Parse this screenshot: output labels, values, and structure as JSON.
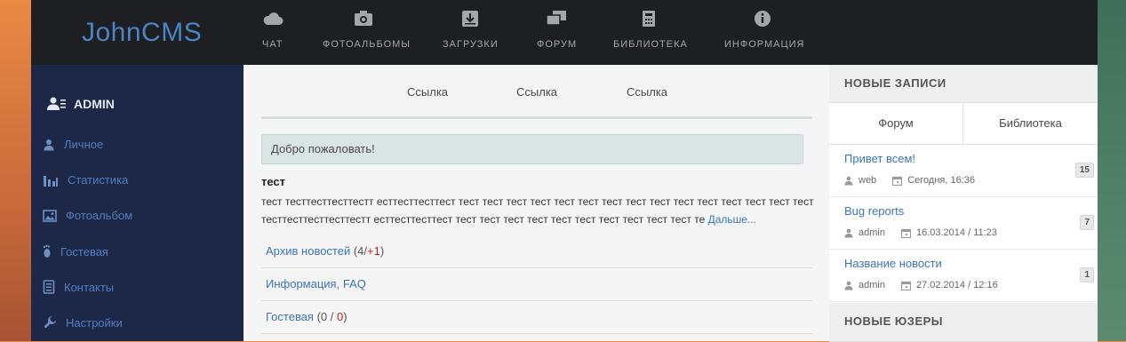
{
  "brand": "JohnCMS",
  "nav": [
    {
      "label": "ЧАТ",
      "icon": "cloud-icon"
    },
    {
      "label": "ФОТОАЛЬБОМЫ",
      "icon": "camera-icon"
    },
    {
      "label": "ЗАГРУЗКИ",
      "icon": "download-box-icon"
    },
    {
      "label": "ФОРУМ",
      "icon": "chat-bubbles-icon"
    },
    {
      "label": "БИБЛИОТЕКА",
      "icon": "book-icon"
    },
    {
      "label": "ИНФОРМАЦИЯ",
      "icon": "info-icon"
    }
  ],
  "sidebar": {
    "user": "ADMIN",
    "items": [
      {
        "label": "Личное",
        "icon": "user-icon"
      },
      {
        "label": "Статистика",
        "icon": "bar-chart-icon"
      },
      {
        "label": "Фотоальбом",
        "icon": "picture-icon"
      },
      {
        "label": "Гостевая",
        "icon": "footprint-icon"
      },
      {
        "label": "Контакты",
        "icon": "contacts-icon"
      },
      {
        "label": "Настройки",
        "icon": "wrench-icon"
      }
    ]
  },
  "main": {
    "tabs": [
      "Ссылка",
      "Ссылка",
      "Ссылка"
    ],
    "welcome": "Добро пожаловать!",
    "news": {
      "title": "тест",
      "text": "тест тесттесттесттестт ecттесттесттест тест тест тест тест тест тест тест тест тест тест тест тест тест тест тест тесттесттесттесттестт ecттесттесттест тест тест тест тест тест тест тест тест тест тест те",
      "more": "Дальше..."
    },
    "rows": [
      {
        "link": "Архив новостей",
        "open": " (4/",
        "red": "+1",
        "close": ")"
      },
      {
        "link": "Информация, FAQ"
      },
      {
        "link": "Гостевая",
        "open": " (0 / ",
        "red": "0",
        "close": ")"
      }
    ]
  },
  "right": {
    "new_posts_title": "НОВЫЕ ЗАПИСИ",
    "tabs": [
      "Форум",
      "Библиотека"
    ],
    "posts": [
      {
        "title": "Привет всем!",
        "author": "web",
        "date": "Сегодня, 16:36",
        "count": "15"
      },
      {
        "title": "Bug reports",
        "author": "admin",
        "date": "16.03.2014 / 11:23",
        "count": "7"
      },
      {
        "title": "Название новости",
        "author": "admin",
        "date": "27.02.2014 / 12:16",
        "count": "1"
      }
    ],
    "new_users_title": "НОВЫЕ ЮЗЕРЫ"
  },
  "colors": {
    "accent": "#3a74b6",
    "topbar": "#1d1f23",
    "sidebar": "#1d2849",
    "red": "#c0201e"
  }
}
